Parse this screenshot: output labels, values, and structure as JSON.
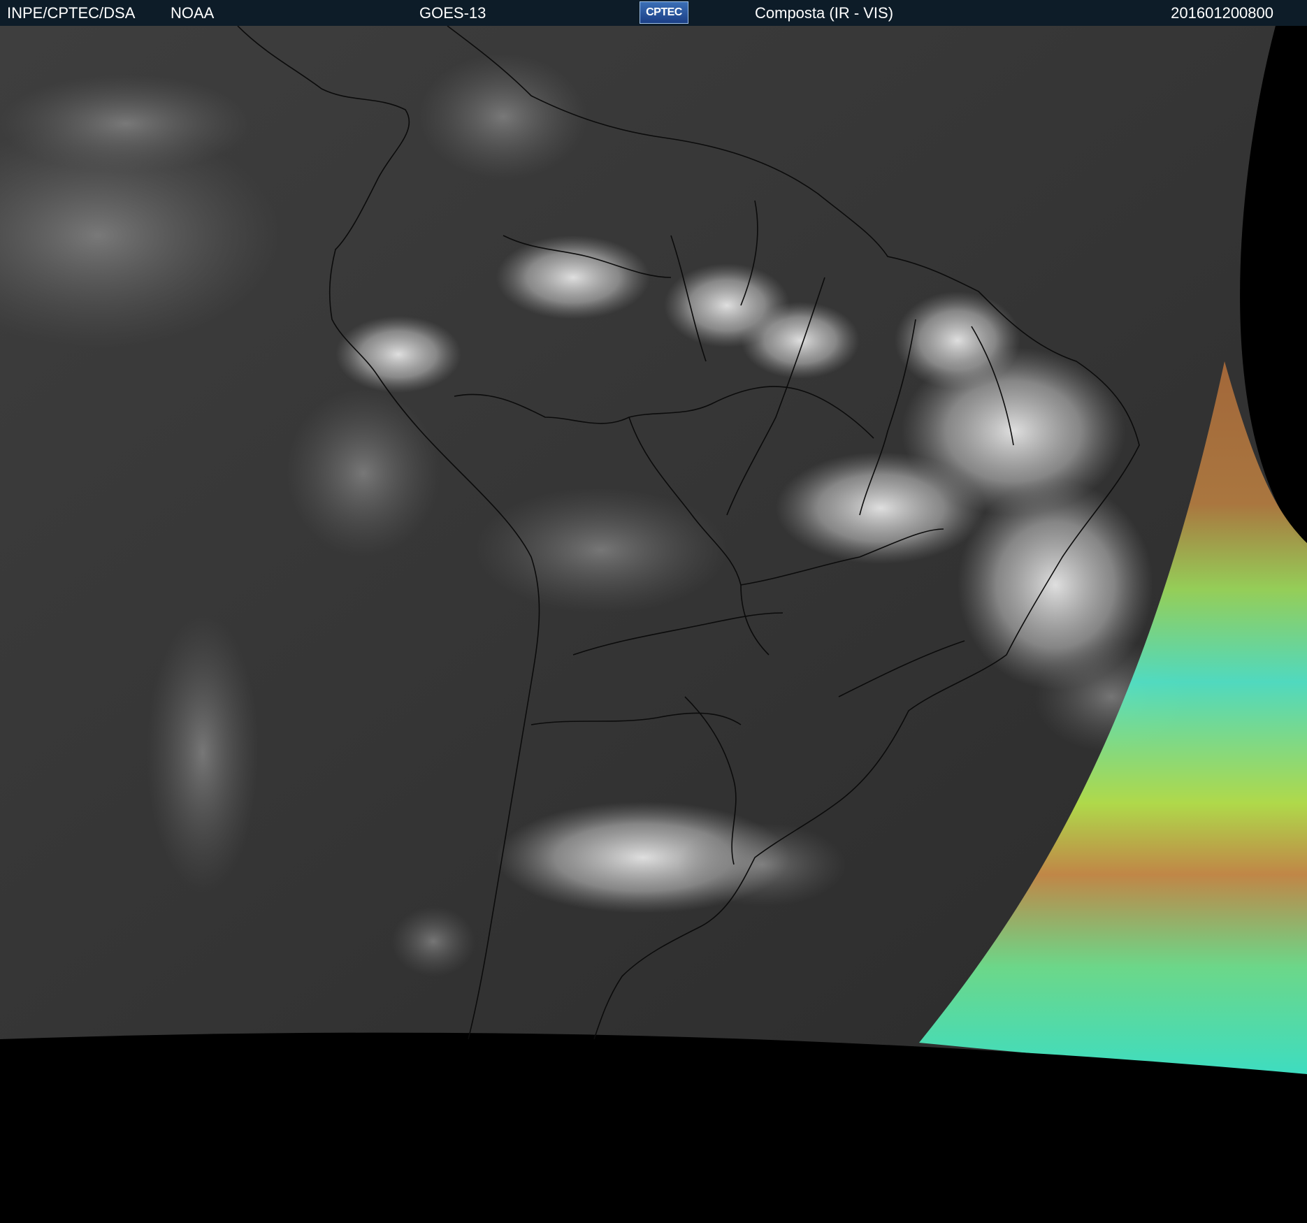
{
  "header": {
    "organization": "INPE/CPTEC/DSA",
    "agency": "NOAA",
    "satellite": "GOES-13",
    "logo_text": "CPTEC",
    "product": "Composta (IR - VIS)",
    "datetime": "201601200800"
  },
  "imagery": {
    "scene": "satellite composite over South America",
    "icons": [
      "cptec-logo-icon"
    ],
    "colors": {
      "header_bg": "#0d1c28",
      "ir_gray": "#3a3a3a",
      "cloud_white": "#e0e0e0",
      "vis_orange": "#b3733c",
      "vis_green": "#a6e04a",
      "vis_cyan": "#3fe6c8",
      "space_black": "#000000"
    }
  }
}
